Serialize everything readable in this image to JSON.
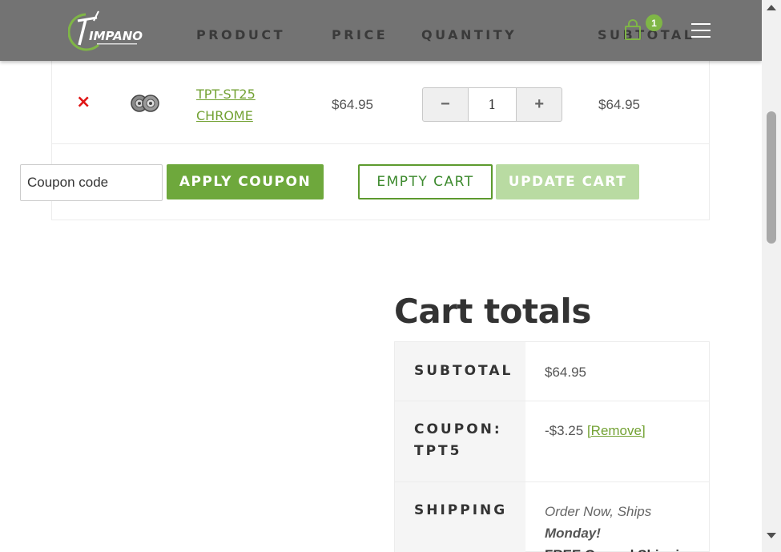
{
  "header": {
    "logo_text": "TIMPANO",
    "columns": {
      "product": "PRODUCT",
      "price": "PRICE",
      "quantity": "QUANTITY",
      "subtotal": "SUBTOTAL"
    },
    "cart_count": "1",
    "icons": [
      "cart-icon",
      "hamburger-menu-icon"
    ]
  },
  "cart": {
    "items": [
      {
        "remove_symbol": "×",
        "name": "TPT-ST25 CHROME",
        "price": "$64.95",
        "quantity": "1",
        "decrement": "−",
        "increment": "+",
        "subtotal": "$64.95"
      }
    ],
    "coupon_placeholder": "Coupon code",
    "apply_coupon": "APPLY COUPON",
    "empty_cart": "EMPTY CART",
    "update_cart": "UPDATE CART"
  },
  "totals": {
    "title": "Cart totals",
    "rows": [
      {
        "label": "SUBTOTAL",
        "value": "$64.95"
      },
      {
        "label": "COUPON: TPT5",
        "value": "-$3.25",
        "link": "[Remove]"
      },
      {
        "label": "SHIPPING",
        "line1": "Order Now, Ships",
        "line2": "Monday!",
        "line3": "FREE Ground Shipping"
      }
    ]
  },
  "colors": {
    "accent_green": "#6ea83c",
    "link_green": "#73a234",
    "remove_red": "#e01515",
    "header_gray": "#6e6e6e"
  }
}
